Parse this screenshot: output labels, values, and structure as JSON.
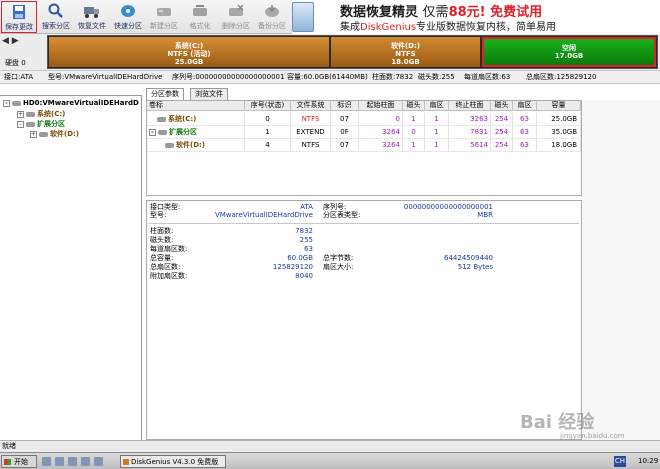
{
  "toolbar": {
    "buttons": [
      {
        "label": "保存更改",
        "icon": "save-icon"
      },
      {
        "label": "搜索分区",
        "icon": "magnifier-icon"
      },
      {
        "label": "恢复文件",
        "icon": "truck-icon"
      },
      {
        "label": "快速分区",
        "icon": "disk-icon"
      },
      {
        "label": "新建分区",
        "icon": "new-partition-icon"
      },
      {
        "label": "格式化",
        "icon": "format-icon"
      },
      {
        "label": "删除分区",
        "icon": "delete-icon"
      },
      {
        "label": "备份分区",
        "icon": "backup-icon"
      }
    ]
  },
  "ad": {
    "title": "数据恢复精灵",
    "price_prefix": "仅需",
    "price": "88元!",
    "free_trial": "免费试用",
    "line2_a": "集成",
    "line2_brand": "DiskGenius",
    "line2_b": "专业版数据恢复内核，简单易用"
  },
  "disk": {
    "nav_arrows": "◀ ▶",
    "label": "硬盘 0",
    "segments": [
      {
        "name": "系统(C:)",
        "fs": "NTFS (活动)",
        "size": "25.0GB"
      },
      {
        "name": "软件(D:)",
        "fs": "NTFS",
        "size": "18.0GB"
      },
      {
        "name": "空闲",
        "size": "17.0GB"
      }
    ]
  },
  "infoline": {
    "interface": "接口:ATA",
    "model": "型号:VMwareVirtualIDEHardDrive",
    "serial": "序列号:00000000000000000001",
    "capacity": "容量:60.0GB(61440MB)",
    "cylinders": "柱面数:7832",
    "heads": "磁头数:255",
    "sectors_per_track": "每道扇区数:63",
    "total_sectors": "总扇区数:125829120"
  },
  "tree": {
    "root": "HD0:VMwareVirtualIDEHardD",
    "items": [
      "系统(C:)",
      "扩展分区",
      "软件(D:)"
    ]
  },
  "tabs": [
    "分区参数",
    "浏览文件"
  ],
  "table": {
    "headers": [
      "卷标",
      "序号(状态)",
      "文件系统",
      "标识",
      "起始柱面",
      "磁头",
      "扇区",
      "终止柱面",
      "磁头",
      "扇区",
      "容量"
    ],
    "rows": [
      {
        "label": "系统(C:)",
        "index": "0",
        "fs": "NTFS",
        "id": "07",
        "start_cyl": "0",
        "start_head": "1",
        "start_sec": "1",
        "end_cyl": "3263",
        "end_head": "254",
        "end_sec": "63",
        "size": "25.0GB"
      },
      {
        "label": "扩展分区",
        "index": "1",
        "fs": "EXTEND",
        "id": "0F",
        "start_cyl": "3264",
        "start_head": "0",
        "start_sec": "1",
        "end_cyl": "7831",
        "end_head": "254",
        "end_sec": "63",
        "size": "35.0GB"
      },
      {
        "label": "软件(D:)",
        "index": "4",
        "fs": "NTFS",
        "id": "07",
        "start_cyl": "3264",
        "start_head": "1",
        "start_sec": "1",
        "end_cyl": "5614",
        "end_head": "254",
        "end_sec": "63",
        "size": "18.0GB"
      }
    ]
  },
  "details": {
    "interface_label": "接口类型:",
    "interface_value": "ATA",
    "model_label": "型号:",
    "model_value": "VMwareVirtualIDEHardDrive",
    "serial_label": "序列号:",
    "serial_value": "00000000000000000001",
    "ptable_label": "分区表类型:",
    "ptable_value": "MBR",
    "cyl_label": "柱面数:",
    "cyl_value": "7832",
    "heads_label": "磁头数:",
    "heads_value": "255",
    "spt_label": "每道扇区数:",
    "spt_value": "63",
    "cap_label": "总容量:",
    "cap_value": "60.0GB",
    "bytes_label": "总字节数:",
    "bytes_value": "64424509440",
    "sectors_label": "总扇区数:",
    "sectors_value": "125829120",
    "secsize_label": "扇区大小:",
    "secsize_value": "512 Bytes",
    "extra_label": "附加扇区数:",
    "extra_value": "8040"
  },
  "status": "就绪",
  "taskbar": {
    "start": "开始",
    "app": "DiskGenius V4.3.0 免费版",
    "tray": "CH",
    "clock": "10:29"
  },
  "watermark": {
    "text": "Bai 经验",
    "sub": "jingyan.baidu.com"
  }
}
